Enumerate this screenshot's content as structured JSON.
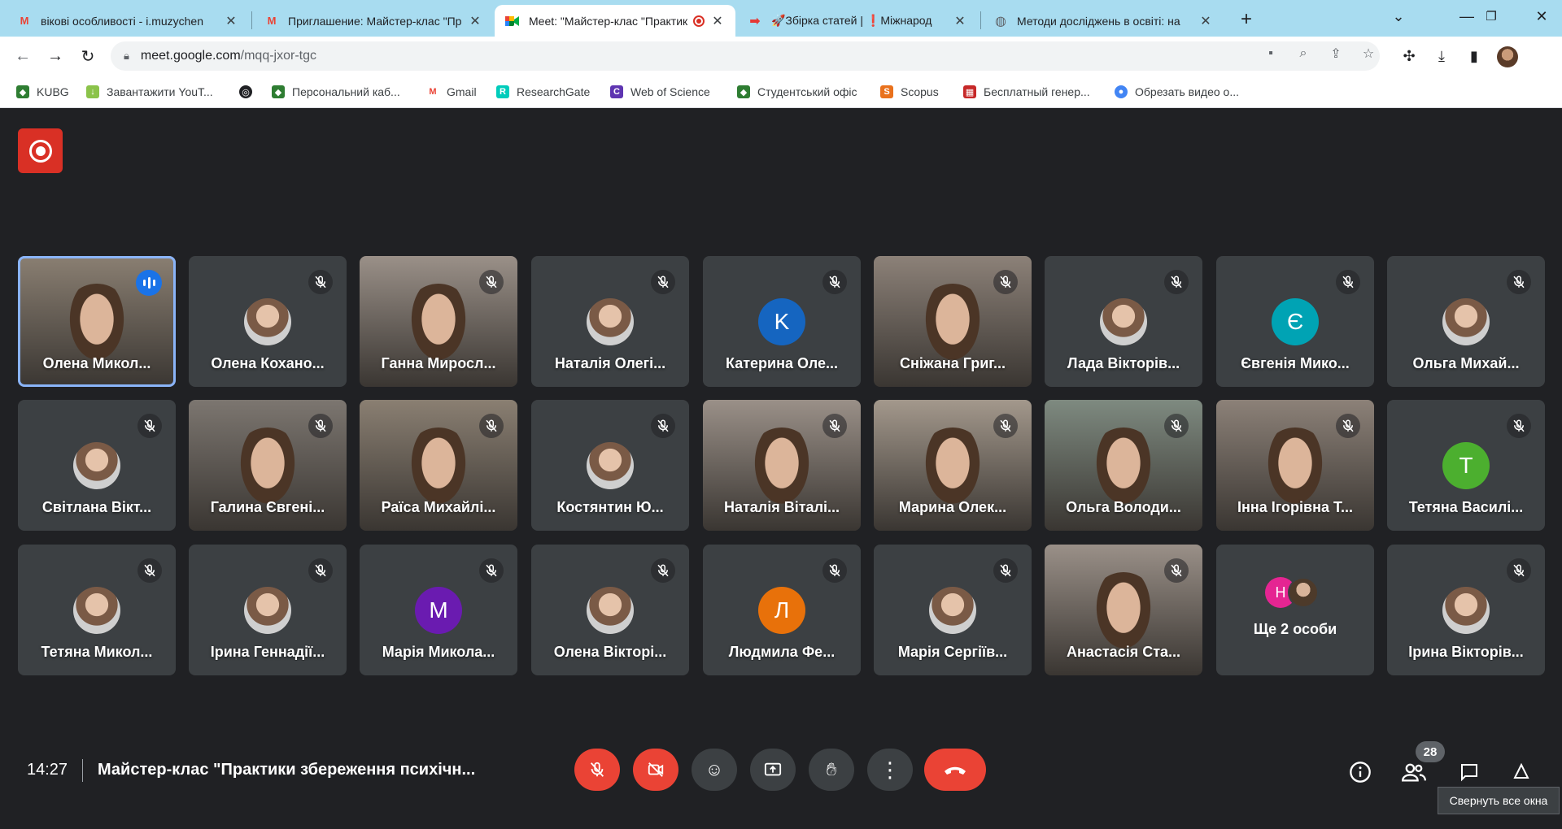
{
  "browser": {
    "tabs": [
      {
        "title": "вікові особливості - i.muzychen",
        "favicon": "gmail-icon"
      },
      {
        "title": "Приглашение: Майстер-клас \"Пра",
        "favicon": "gmail-icon"
      },
      {
        "title": "Meet: \"Майстер-клас \"Практики",
        "favicon": "meet-icon",
        "active": true
      },
      {
        "title": "🚀Збірка статей | ❗Міжнарод",
        "favicon": "red-arrow-icon"
      },
      {
        "title": "Методи досліджень в освіті: на",
        "favicon": "globe-icon"
      }
    ],
    "url_host": "meet.google.com",
    "url_path": "/mqq-jxor-tgc",
    "bookmarks": [
      {
        "label": "KUBG",
        "color": "#2e7d32"
      },
      {
        "label": "Завантажити YouT...",
        "color": "#8bc34a"
      },
      {
        "label": "",
        "color": "#202124"
      },
      {
        "label": "Персональний каб...",
        "color": "#2e7d32"
      },
      {
        "label": "Gmail",
        "color": "#ea4335"
      },
      {
        "label": "ResearchGate",
        "color": "#00ccbb"
      },
      {
        "label": "Web of Science",
        "color": "#5e35b1"
      },
      {
        "label": "Студентський офіс",
        "color": "#2e7d32"
      },
      {
        "label": "Scopus",
        "color": "#e9711c"
      },
      {
        "label": "Бесплатный генер...",
        "color": "#c62828"
      },
      {
        "label": "Обрезать видео о...",
        "color": "#4285f4"
      }
    ]
  },
  "meet": {
    "participants": [
      {
        "name": "Олена Микол...",
        "kind": "video",
        "speaking": true
      },
      {
        "name": "Олена Кохано...",
        "kind": "photo"
      },
      {
        "name": "Ганна Миросл...",
        "kind": "video"
      },
      {
        "name": "Наталія Олегі...",
        "kind": "photo"
      },
      {
        "name": "Катерина Оле...",
        "kind": "letter",
        "letter": "K",
        "color": "#1565c0"
      },
      {
        "name": "Сніжана Григ...",
        "kind": "video"
      },
      {
        "name": "Лада Вікторів...",
        "kind": "photo"
      },
      {
        "name": "Євгенія Мико...",
        "kind": "letter",
        "letter": "Є",
        "color": "#00a3b4"
      },
      {
        "name": "Ольга Михай...",
        "kind": "photo"
      },
      {
        "name": "Світлана Вікт...",
        "kind": "photo"
      },
      {
        "name": "Галина Євгені...",
        "kind": "video"
      },
      {
        "name": "Раїса Михайлі...",
        "kind": "video"
      },
      {
        "name": "Костянтин Ю...",
        "kind": "photo"
      },
      {
        "name": "Наталія Віталі...",
        "kind": "video"
      },
      {
        "name": "Марина Олек...",
        "kind": "video"
      },
      {
        "name": "Ольга Володи...",
        "kind": "video"
      },
      {
        "name": "Інна Ігорівна Т...",
        "kind": "video"
      },
      {
        "name": "Тетяна Василі...",
        "kind": "letter",
        "letter": "T",
        "color": "#4caf2f"
      },
      {
        "name": "Тетяна Микол...",
        "kind": "photo"
      },
      {
        "name": "Ірина Геннадії...",
        "kind": "photo"
      },
      {
        "name": "Марія Микола...",
        "kind": "letter",
        "letter": "M",
        "color": "#6a1bb0"
      },
      {
        "name": "Олена Вікторі...",
        "kind": "photo"
      },
      {
        "name": "Людмила Фе...",
        "kind": "letter",
        "letter": "Л",
        "color": "#e8710a"
      },
      {
        "name": "Марія Сергіїв...",
        "kind": "photo"
      },
      {
        "name": "Анастасія Ста...",
        "kind": "video"
      },
      {
        "name": "Ще 2 особи",
        "kind": "more",
        "letter": "H"
      },
      {
        "name": "Ірина Вікторів...",
        "kind": "photo"
      }
    ],
    "clock": "14:27",
    "meeting_title": "Майстер-клас \"Практики збереження психічн...",
    "participant_count": "28",
    "tooltip": "Свернуть все окна"
  }
}
